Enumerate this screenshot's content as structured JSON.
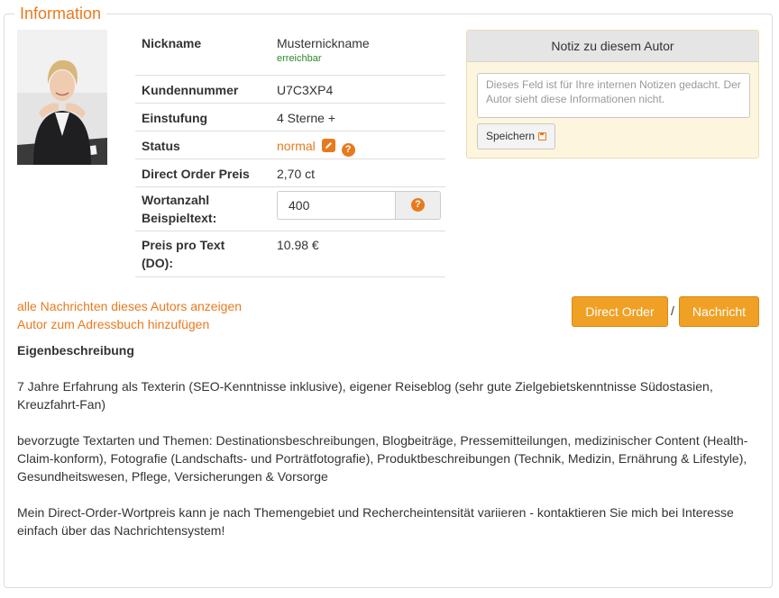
{
  "legend": "Information",
  "photo_alt": "Autorenfoto",
  "info": {
    "nickname_label": "Nickname",
    "nickname_value": "Musternickname",
    "nickname_status": "erreichbar",
    "kundennummer_label": "Kundennummer",
    "kundennummer_value": "U7C3XP4",
    "einstufung_label": "Einstufung",
    "einstufung_value": "4 Sterne +",
    "status_label": "Status",
    "status_value": "normal",
    "direct_order_label": "Direct Order Preis",
    "direct_order_value": "2,70 ct",
    "wortanzahl_label_1": "Wortanzahl",
    "wortanzahl_label_2": "Beispieltext:",
    "wortanzahl_value": "400",
    "preis_label_1": "Preis pro Text",
    "preis_label_2": "(DO):",
    "preis_value": "10.98 €"
  },
  "notiz": {
    "title": "Notiz zu diesem Autor",
    "placeholder": "Dieses Feld ist für Ihre internen Notizen gedacht. Der Autor sieht diese Informationen nicht.",
    "save_label": "Speichern"
  },
  "links": {
    "all_messages": "alle Nachrichten dieses Autors anzeigen",
    "add_addressbook": "Autor zum Adressbuch hinzufügen"
  },
  "buttons": {
    "direct_order": "Direct Order",
    "separator": "/",
    "nachricht": "Nachricht"
  },
  "description": {
    "title": "Eigenbeschreibung",
    "p1": "7 Jahre Erfahrung als Texterin (SEO-Kenntnisse inklusive), eigener Reiseblog (sehr gute Zielgebietskenntnisse Südostasien, Kreuzfahrt-Fan)",
    "p2": "bevorzugte Textarten und Themen: Destinationsbeschreibungen, Blogbeiträge, Pressemitteilungen, medizinischer Content (Health-Claim-konform), Fotografie (Landschafts- und Porträtfotografie), Produktbeschreibungen (Technik, Medizin, Ernährung & Lifestyle), Gesundheitswesen, Pflege, Versicherungen & Vorsorge",
    "p3": "Mein Direct-Order-Wortpreis kann je nach Themengebiet und Rechercheintensität variieren - kontaktieren Sie mich bei Interesse einfach über das Nachrichtensystem!"
  },
  "colors": {
    "accent": "#e87a1e",
    "button": "#f0a024",
    "note_bg": "#fdf5dd",
    "online": "#2a8a2a"
  },
  "icons": [
    "pencil-icon",
    "question-icon",
    "floppy-icon"
  ]
}
